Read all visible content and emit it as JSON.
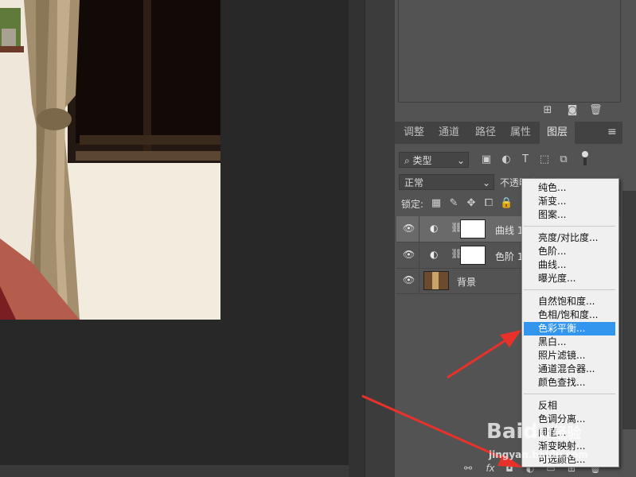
{
  "panel_tabs": [
    "调整",
    "通道",
    "路径",
    "属性",
    "图层"
  ],
  "active_tab": "图层",
  "filter": {
    "label": "类型"
  },
  "blend_mode": "正常",
  "opacity_label": "不透明度",
  "lock_label": "锁定:",
  "layers": [
    {
      "name": "曲线 1",
      "type": "adjustment",
      "selected": true
    },
    {
      "name": "色阶 1",
      "type": "adjustment",
      "selected": false
    },
    {
      "name": "背景",
      "type": "image",
      "selected": false
    }
  ],
  "menu": {
    "groups": [
      [
        "纯色...",
        "渐变...",
        "图案..."
      ],
      [
        "亮度/对比度...",
        "色阶...",
        "曲线...",
        "曝光度..."
      ],
      [
        "自然饱和度...",
        "色相/饱和度...",
        "色彩平衡...",
        "黑白...",
        "照片滤镜...",
        "通道混合器...",
        "颜色查找..."
      ],
      [
        "反相",
        "色调分离...",
        "阈值...",
        "渐变映射...",
        "可选颜色..."
      ]
    ],
    "highlighted": "色彩平衡..."
  },
  "watermark": {
    "brand": "Baidu",
    "cn": "经验",
    "url": "jingyan.baidu.com"
  },
  "colors": {
    "highlight": "#3296ee",
    "arrow": "#e8312a",
    "panel": "#535353"
  }
}
